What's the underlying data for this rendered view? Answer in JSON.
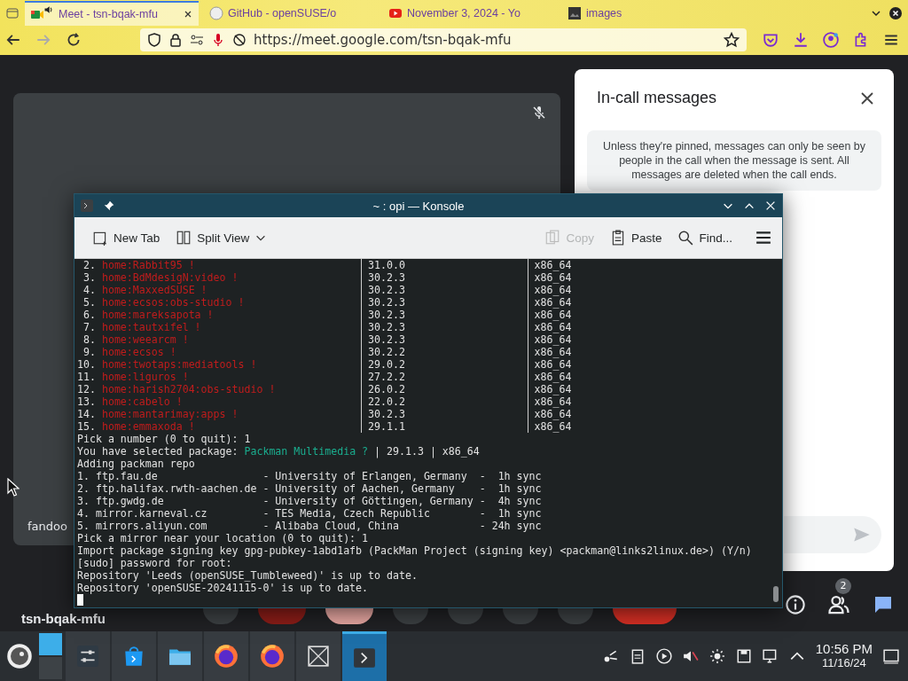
{
  "browser": {
    "tabs": [
      {
        "title": "Meet - tsn-bqak-mfu",
        "selected": true,
        "kind": "meet"
      },
      {
        "title": "GitHub - openSUSE/o",
        "selected": false,
        "kind": "github"
      },
      {
        "title": "November 3, 2024 - Yo",
        "selected": false,
        "kind": "youtube"
      },
      {
        "title": "images",
        "selected": false,
        "kind": "image"
      }
    ],
    "url": "https://meet.google.com/tsn-bqak-mfu"
  },
  "meet": {
    "tile_name": "fandoo",
    "meeting_code": "tsn-bqak-mfu",
    "participants_badge": "2",
    "panel": {
      "title": "In-call messages",
      "notice": "Unless they're pinned, messages can only be seen by people in the call when the message is sent. All messages are deleted when the call ends."
    }
  },
  "konsole": {
    "title": "~ : opi — Konsole",
    "toolbar": [
      {
        "label": "New Tab",
        "kind": "newtab",
        "disabled": false
      },
      {
        "label": "Split View",
        "kind": "split",
        "disabled": false
      },
      {
        "label": "Copy",
        "kind": "copy",
        "disabled": true
      },
      {
        "label": "Paste",
        "kind": "paste",
        "disabled": false
      },
      {
        "label": "Find...",
        "kind": "find",
        "disabled": false
      }
    ],
    "lines": [
      {
        "kind": "repo",
        "number": "2.",
        "name": "home:Rabbit95 !",
        "version": "31.0.0",
        "arch": "x86_64"
      },
      {
        "kind": "repo",
        "number": "3.",
        "name": "home:BdMdesigN:video !",
        "version": "30.2.3",
        "arch": "x86_64"
      },
      {
        "kind": "repo",
        "number": "4.",
        "name": "home:MaxxedSUSE !",
        "version": "30.2.3",
        "arch": "x86_64"
      },
      {
        "kind": "repo",
        "number": "5.",
        "name": "home:ecsos:obs-studio !",
        "version": "30.2.3",
        "arch": "x86_64"
      },
      {
        "kind": "repo",
        "number": "6.",
        "name": "home:mareksapota !",
        "version": "30.2.3",
        "arch": "x86_64"
      },
      {
        "kind": "repo",
        "number": "7.",
        "name": "home:tautxifel !",
        "version": "30.2.3",
        "arch": "x86_64"
      },
      {
        "kind": "repo",
        "number": "8.",
        "name": "home:weearcm !",
        "version": "30.2.3",
        "arch": "x86_64"
      },
      {
        "kind": "repo",
        "number": "9.",
        "name": "home:ecsos !",
        "version": "30.2.2",
        "arch": "x86_64"
      },
      {
        "kind": "repo",
        "number": "10.",
        "name": "home:twotaps:mediatools !",
        "version": "29.0.2",
        "arch": "x86_64"
      },
      {
        "kind": "repo",
        "number": "11.",
        "name": "home:liguros !",
        "version": "27.2.2",
        "arch": "x86_64"
      },
      {
        "kind": "repo",
        "number": "12.",
        "name": "home:harish2704:obs-studio !",
        "version": "26.0.2",
        "arch": "x86_64"
      },
      {
        "kind": "repo",
        "number": "13.",
        "name": "home:cabelo !",
        "version": "22.0.2",
        "arch": "x86_64"
      },
      {
        "kind": "repo",
        "number": "14.",
        "name": "home:mantarimay:apps !",
        "version": "30.2.3",
        "arch": "x86_64"
      },
      {
        "kind": "repo",
        "number": "15.",
        "name": "home:emmaxoda !",
        "version": "29.1.1",
        "arch": "x86_64"
      },
      {
        "kind": "plain",
        "text": "Pick a number (0 to quit): 1"
      },
      {
        "kind": "selected",
        "prefix": "You have selected package: ",
        "highlight": "Packman Multimedia ?",
        "suffix": " | 29.1.3 | x86_64"
      },
      {
        "kind": "plain",
        "text": "Adding packman repo"
      },
      {
        "kind": "plain",
        "text": "1. ftp.fau.de                 - University of Erlangen, Germany  -  1h sync"
      },
      {
        "kind": "plain",
        "text": "2. ftp.halifax.rwth-aachen.de - University of Aachen, Germany    -  1h sync"
      },
      {
        "kind": "plain",
        "text": "3. ftp.gwdg.de                - University of Göttingen, Germany -  4h sync"
      },
      {
        "kind": "plain",
        "text": "4. mirror.karneval.cz         - TES Media, Czech Republic        -  1h sync"
      },
      {
        "kind": "plain",
        "text": "5. mirrors.aliyun.com         - Alibaba Cloud, China             - 24h sync"
      },
      {
        "kind": "plain",
        "text": "Pick a mirror near your location (0 to quit): 1"
      },
      {
        "kind": "plain",
        "text": "Import package signing key gpg-pubkey-1abd1afb (PackMan Project (signing key) <packman@links2linux.de>) (Y/n)"
      },
      {
        "kind": "plain",
        "text": "[sudo] password for root:"
      },
      {
        "kind": "plain",
        "text": "Repository 'Leeds (openSUSE_Tumbleweed)' is up to date."
      },
      {
        "kind": "plain",
        "text": "Repository 'openSUSE-20241115-0' is up to date."
      },
      {
        "kind": "cursor"
      }
    ]
  },
  "taskbar": {
    "apps": [
      {
        "kind": "settings",
        "active": false
      },
      {
        "kind": "discover",
        "active": false
      },
      {
        "kind": "files",
        "active": false
      },
      {
        "kind": "firefox",
        "active": false
      },
      {
        "kind": "firefox",
        "active": false
      },
      {
        "kind": "screenshot",
        "active": false
      },
      {
        "kind": "konsole",
        "active": true
      }
    ],
    "time": "10:56 PM",
    "date": "11/16/24"
  }
}
